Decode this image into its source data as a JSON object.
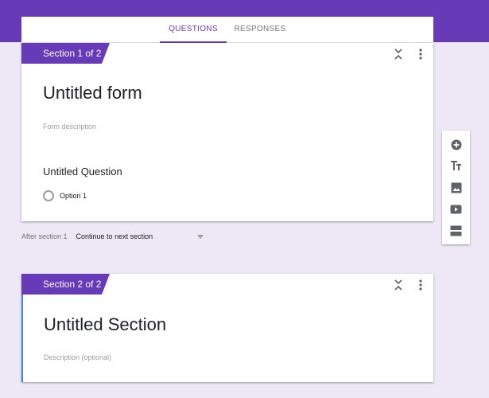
{
  "tabs": {
    "questions": "QUESTIONS",
    "responses": "RESPONSES"
  },
  "section1": {
    "tag": "Section 1 of 2",
    "form_title": "Untitled form",
    "form_description_placeholder": "Form description",
    "question_title": "Untitled Question",
    "option_label": "Option 1"
  },
  "after_section": {
    "label": "After section 1",
    "selected": "Continue to next section"
  },
  "section2": {
    "tag": "Section 2 of 2",
    "title": "Untitled Section",
    "description_placeholder": "Description (optional)"
  },
  "icons": {
    "collapse": "collapse-icon",
    "more": "more-vert-icon",
    "add_question": "add-circle-icon",
    "add_title": "title-text-icon",
    "add_image": "image-icon",
    "add_video": "video-icon",
    "add_section": "section-icon"
  },
  "colors": {
    "accent": "#673ab7",
    "background": "#ede7f6",
    "section_focus": "#4285f4",
    "icon": "#5f6368"
  }
}
